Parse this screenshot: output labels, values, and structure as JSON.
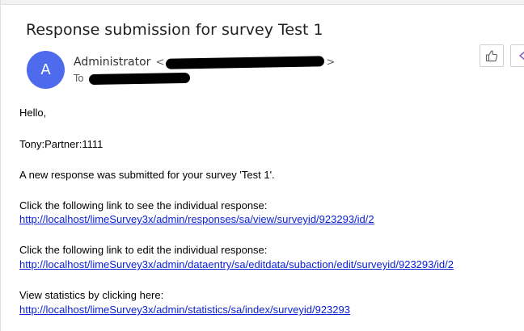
{
  "email": {
    "subject": "Response submission for survey Test 1",
    "avatar_initial": "A",
    "sender_name": "Administrator",
    "sender_open": "<",
    "sender_close": ">",
    "to_label": "To"
  },
  "body": {
    "greeting": "Hello,",
    "user_line": "Tony:Partner:1111",
    "notice": "A new response was submitted for your survey 'Test 1'.",
    "view_text": "Click the following link to see the individual response:",
    "view_link": "http://localhost/limeSurvey3x/admin/responses/sa/view/surveyid/923293/id/2",
    "edit_text": "Click the following link to edit the individual response:",
    "edit_link": "http://localhost/limeSurvey3x/admin/dataentry/sa/editdata/subaction/edit/surveyid/923293/id/2",
    "stats_text": "View statistics by clicking here:",
    "stats_link": "http://localhost/limeSurvey3x/admin/statistics/sa/index/surveyid/923293"
  },
  "icons": {
    "like": "thumbs-up-icon",
    "more": "reply-icon"
  },
  "colors": {
    "avatar": "#4f6bed",
    "link": "#0b20d6",
    "reply_accent": "#8764b8"
  }
}
